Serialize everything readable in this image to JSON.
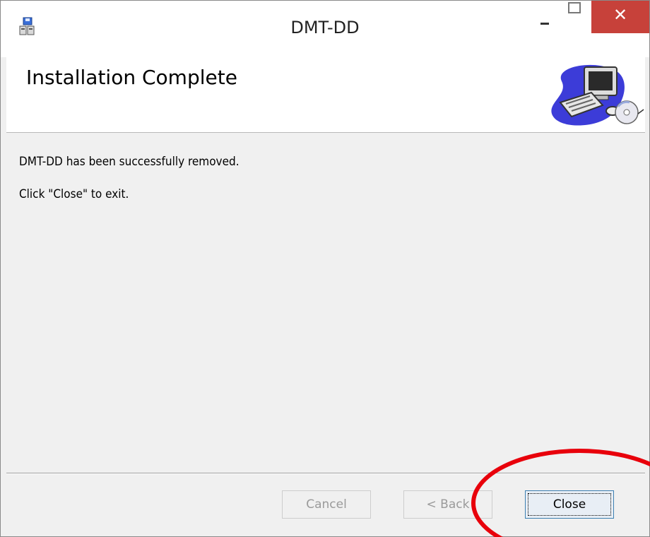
{
  "window": {
    "title": "DMT-DD",
    "close_glyph": "✕"
  },
  "header": {
    "title": "Installation Complete",
    "graphic_icon": "computer-cd-icon"
  },
  "body": {
    "message_1": "DMT-DD has been successfully removed.",
    "message_2": "Click \"Close\" to exit."
  },
  "buttons": {
    "cancel_label": "Cancel",
    "back_label": "< Back",
    "close_label": "Close"
  },
  "colors": {
    "close_button": "#c7413a",
    "annotation_circle": "#e8000b"
  }
}
